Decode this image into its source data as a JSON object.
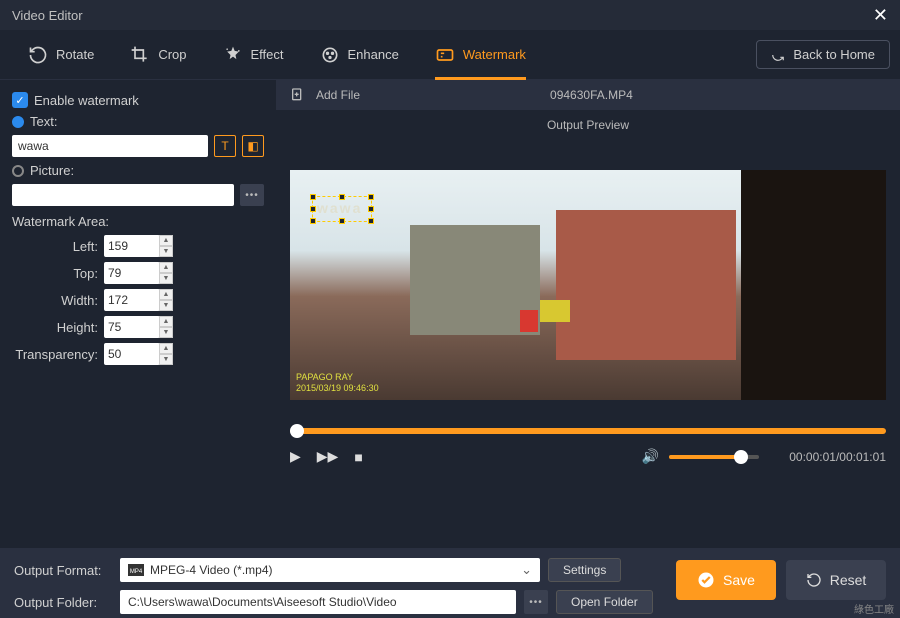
{
  "window": {
    "title": "Video Editor"
  },
  "tabs": {
    "rotate": "Rotate",
    "crop": "Crop",
    "effect": "Effect",
    "enhance": "Enhance",
    "watermark": "Watermark"
  },
  "home_button": "Back to Home",
  "sidebar": {
    "enable_label": "Enable watermark",
    "text_label": "Text:",
    "text_value": "wawa",
    "picture_label": "Picture:",
    "picture_value": "",
    "area_title": "Watermark Area:",
    "left_label": "Left:",
    "top_label": "Top:",
    "width_label": "Width:",
    "height_label": "Height:",
    "transparency_label": "Transparency:",
    "left": "159",
    "top": "79",
    "width": "172",
    "height": "75",
    "transparency": "50"
  },
  "file_bar": {
    "add_file": "Add File",
    "filename": "094630FA.MP4"
  },
  "preview": {
    "label": "Output Preview",
    "watermark_text": "wawa",
    "overlay_line1": "PAPAGO RAY",
    "overlay_line2": "2015/03/19 09:46:30"
  },
  "playback": {
    "current": "00:00:01",
    "total": "00:01:01"
  },
  "output": {
    "format_label": "Output Format:",
    "format_value": "MPEG-4 Video (*.mp4)",
    "settings": "Settings",
    "folder_label": "Output Folder:",
    "folder_value": "C:\\Users\\wawa\\Documents\\Aiseesoft Studio\\Video",
    "open_folder": "Open Folder"
  },
  "actions": {
    "save": "Save",
    "reset": "Reset"
  },
  "footer": "綠色工廠"
}
